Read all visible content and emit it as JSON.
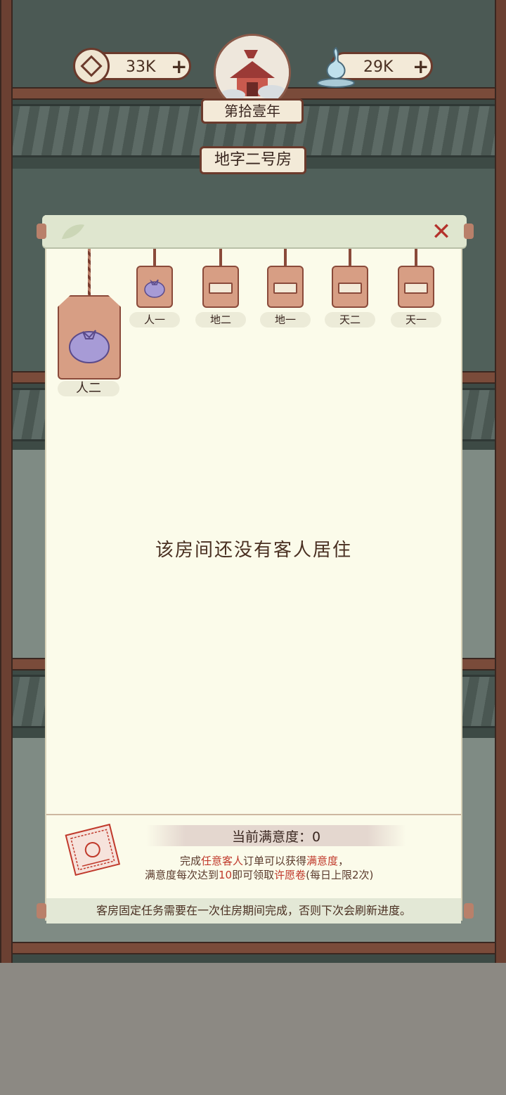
{
  "header": {
    "coins": {
      "value": "33K",
      "plus": "+",
      "icon": "coin-icon"
    },
    "essence": {
      "value": "29K",
      "plus": "+",
      "icon": "gourd-icon"
    },
    "year": "第拾壹年",
    "room_name": "地字二号房"
  },
  "panel": {
    "close_icon": "close-icon",
    "selected_room": {
      "label": "人二",
      "icon": "bundle-icon"
    },
    "rooms": [
      {
        "label": "人一",
        "icon": "bundle-icon"
      },
      {
        "label": "地二",
        "icon": "empty-slot-icon"
      },
      {
        "label": "地一",
        "icon": "empty-slot-icon"
      },
      {
        "label": "天二",
        "icon": "empty-slot-icon"
      },
      {
        "label": "天一",
        "icon": "empty-slot-icon"
      }
    ],
    "empty_message": "该房间还没有客人居住",
    "satisfaction": {
      "label": "当前满意度：0",
      "line1_a": "完成",
      "line1_b": "任意客人",
      "line1_c": "订单可以获得",
      "line1_d": "满意度",
      "line1_e": "，",
      "line2_a": "满意度每次达到",
      "line2_b": "10",
      "line2_c": "即可领取",
      "line2_d": "许愿卷",
      "line2_e": "(每日上限2次)"
    },
    "footer_note": "客房固定任务需要在一次住房期间完成，否则下次会刷新进度。"
  },
  "colors": {
    "accent_red": "#c0392b",
    "tag": "#d79e84",
    "paper": "#fbfbea"
  }
}
